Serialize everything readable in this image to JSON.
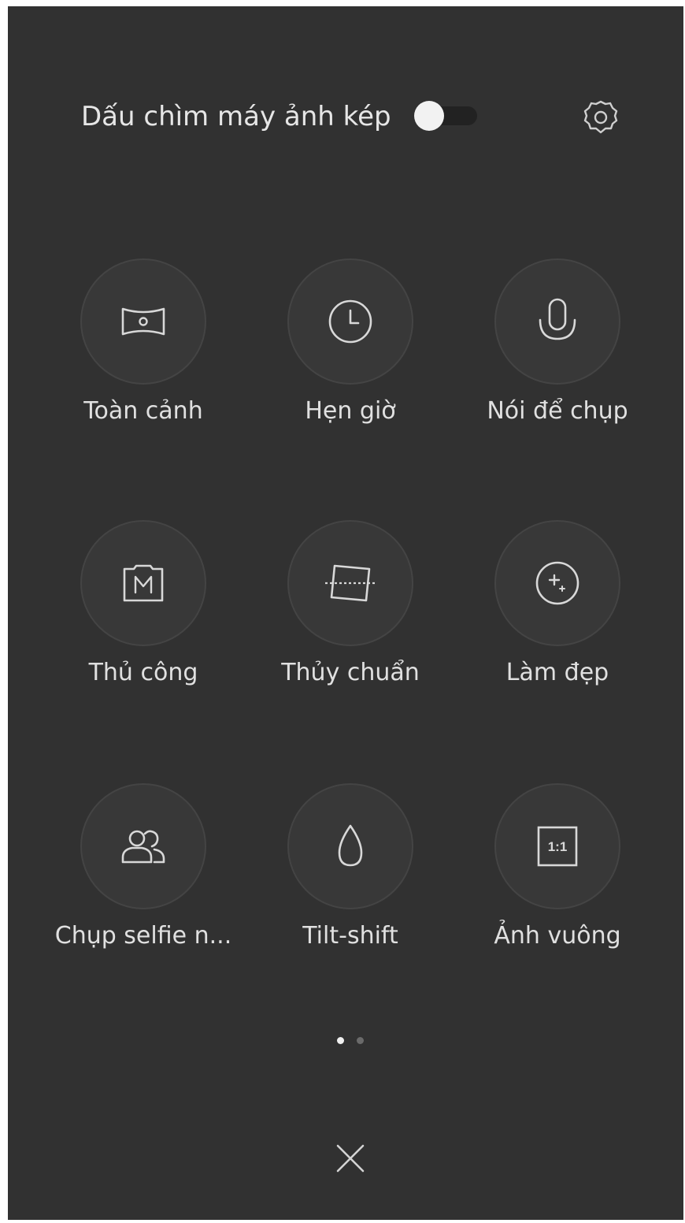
{
  "header": {
    "watermark_label": "Dấu chìm máy ảnh kép",
    "watermark_toggle_state": "on",
    "settings_icon": "gear-icon"
  },
  "modes": [
    {
      "label": "Toàn cảnh",
      "icon": "panorama-icon"
    },
    {
      "label": "Hẹn giờ",
      "icon": "clock-icon"
    },
    {
      "label": "Nói để chụp",
      "icon": "microphone-icon"
    },
    {
      "label": "Thủ công",
      "icon": "manual-m-icon"
    },
    {
      "label": "Thủy chuẩn",
      "icon": "level-icon"
    },
    {
      "label": "Làm đẹp",
      "icon": "beauty-sparkle-icon"
    },
    {
      "label": "Chụp selfie n...",
      "icon": "group-selfie-icon"
    },
    {
      "label": "Tilt-shift",
      "icon": "droplet-icon"
    },
    {
      "label": "Ảnh vuông",
      "icon": "square-1-1-icon",
      "icon_text": "1:1"
    }
  ],
  "pagination": {
    "current_page": 1,
    "total_pages": 2
  },
  "footer": {
    "close_icon": "close-icon"
  },
  "colors": {
    "background": "#313131",
    "tile_circle": "#383838",
    "text": "#e0e0e0",
    "toggle_knob": "#f2f2f2"
  }
}
